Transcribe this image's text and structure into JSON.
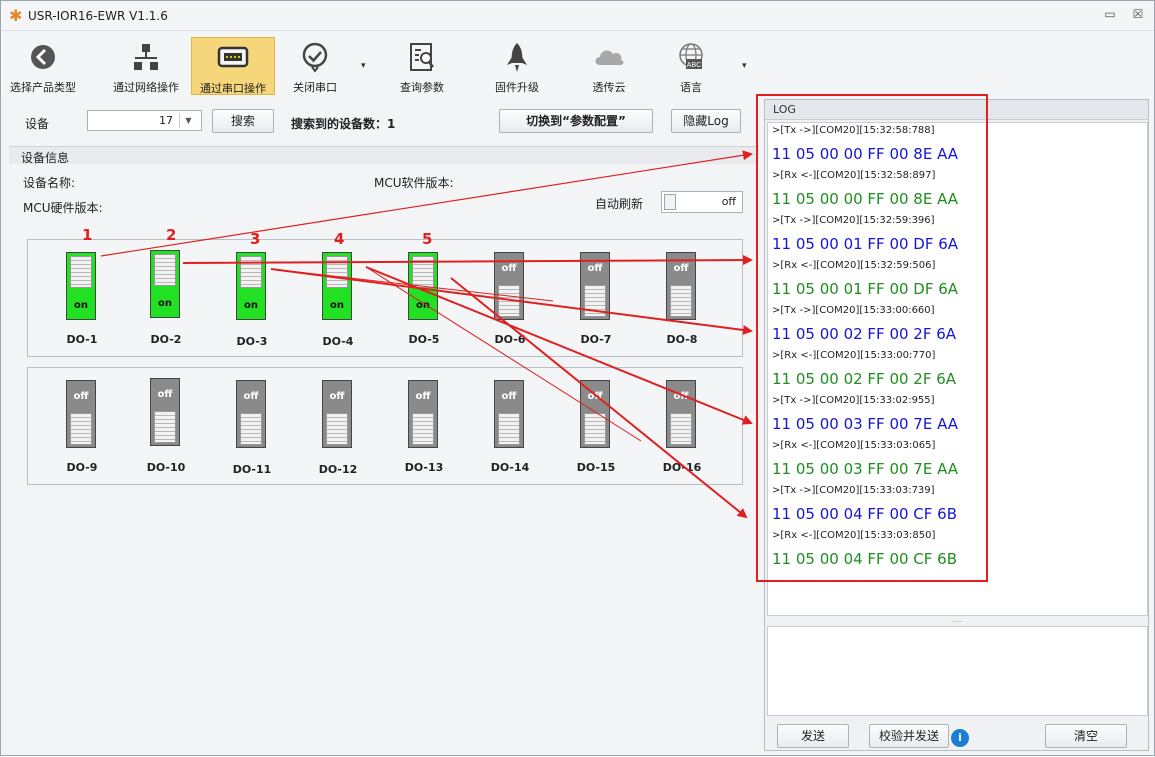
{
  "window": {
    "title": "USR-IOR16-EWR V1.1.6",
    "minimize_glyph": "▭",
    "close_glyph": "☒"
  },
  "toolbar": {
    "items": [
      {
        "label": "选择产品类型",
        "icon": "back-arrow-icon"
      },
      {
        "label": "通过网络操作",
        "icon": "network-icon"
      },
      {
        "label": "通过串口操作",
        "icon": "serial-port-icon"
      },
      {
        "label": "关闭串口",
        "icon": "check-circle-icon"
      },
      {
        "label": "查询参数",
        "icon": "query-icon"
      },
      {
        "label": "固件升级",
        "icon": "rocket-icon"
      },
      {
        "label": "透传云",
        "icon": "cloud-icon"
      },
      {
        "label": "语言",
        "icon": "globe-abc-icon"
      }
    ],
    "caret": "▾"
  },
  "device_row": {
    "device_label": "设备",
    "device_value": "17",
    "dropdown_glyph": "▼",
    "search_button": "搜索",
    "found_text": "搜索到的设备数：1",
    "switch_button": "切换到“参数配置”",
    "hide_log_button": "隐藏Log"
  },
  "device_info": {
    "section_title": "设备信息",
    "device_name_label": "设备名称:",
    "mcu_software_label": "MCU软件版本:",
    "mcu_hardware_label": "MCU硬件版本:",
    "auto_refresh_label": "自动刷新",
    "auto_refresh_state": "off"
  },
  "outputs_row1": [
    {
      "name": "DO-1",
      "state": "on",
      "marker": "1"
    },
    {
      "name": "DO-2",
      "state": "on",
      "marker": "2"
    },
    {
      "name": "DO-3",
      "state": "on",
      "marker": "3"
    },
    {
      "name": "DO-4",
      "state": "on",
      "marker": "4"
    },
    {
      "name": "DO-5",
      "state": "on",
      "marker": "5"
    },
    {
      "name": "DO-6",
      "state": "off",
      "marker": ""
    },
    {
      "name": "DO-7",
      "state": "off",
      "marker": ""
    },
    {
      "name": "DO-8",
      "state": "off",
      "marker": ""
    }
  ],
  "outputs_row2": [
    {
      "name": "DO-9",
      "state": "off"
    },
    {
      "name": "DO-10",
      "state": "off"
    },
    {
      "name": "DO-11",
      "state": "off"
    },
    {
      "name": "DO-12",
      "state": "off"
    },
    {
      "name": "DO-13",
      "state": "off"
    },
    {
      "name": "DO-14",
      "state": "off"
    },
    {
      "name": "DO-15",
      "state": "off"
    },
    {
      "name": "DO-16",
      "state": "off"
    }
  ],
  "log": {
    "title": "LOG",
    "splitter_glyph": "....",
    "entries": [
      {
        "kind": "hdr",
        "text": ">[Tx ->][COM20][15:32:58:788]"
      },
      {
        "kind": "tx",
        "text": "11 05 00 00 FF 00 8E AA"
      },
      {
        "kind": "hdr",
        "text": ">[Rx <-][COM20][15:32:58:897]"
      },
      {
        "kind": "rx",
        "text": "11 05 00 00 FF 00 8E AA"
      },
      {
        "kind": "hdr",
        "text": ">[Tx ->][COM20][15:32:59:396]"
      },
      {
        "kind": "tx",
        "text": "11 05 00 01 FF 00 DF 6A"
      },
      {
        "kind": "hdr",
        "text": ">[Rx <-][COM20][15:32:59:506]"
      },
      {
        "kind": "rx",
        "text": "11 05 00 01 FF 00 DF 6A"
      },
      {
        "kind": "hdr",
        "text": ">[Tx ->][COM20][15:33:00:660]"
      },
      {
        "kind": "tx",
        "text": "11 05 00 02 FF 00 2F 6A"
      },
      {
        "kind": "hdr",
        "text": ">[Rx <-][COM20][15:33:00:770]"
      },
      {
        "kind": "rx",
        "text": "11 05 00 02 FF 00 2F 6A"
      },
      {
        "kind": "hdr",
        "text": ">[Tx ->][COM20][15:33:02:955]"
      },
      {
        "kind": "tx",
        "text": "11 05 00 03 FF 00 7E AA"
      },
      {
        "kind": "hdr",
        "text": ">[Rx <-][COM20][15:33:03:065]"
      },
      {
        "kind": "rx",
        "text": "11 05 00 03 FF 00 7E AA"
      },
      {
        "kind": "hdr",
        "text": ">[Tx ->][COM20][15:33:03:739]"
      },
      {
        "kind": "tx",
        "text": "11 05 00 04 FF 00 CF 6B"
      },
      {
        "kind": "hdr",
        "text": ">[Rx <-][COM20][15:33:03:850]"
      },
      {
        "kind": "rx",
        "text": "11 05 00 04 FF 00 CF 6B"
      }
    ]
  },
  "bottom_buttons": {
    "send": "发送",
    "checksum_send": "校验并发送",
    "info_glyph": "i",
    "clear": "清空"
  },
  "colors": {
    "tx_text": "#1515d6",
    "rx_text": "#1e8e1e",
    "on_green": "#22e022",
    "off_gray": "#8a8a8a",
    "annotation_red": "#e02020",
    "active_tool": "#f6d67a"
  }
}
